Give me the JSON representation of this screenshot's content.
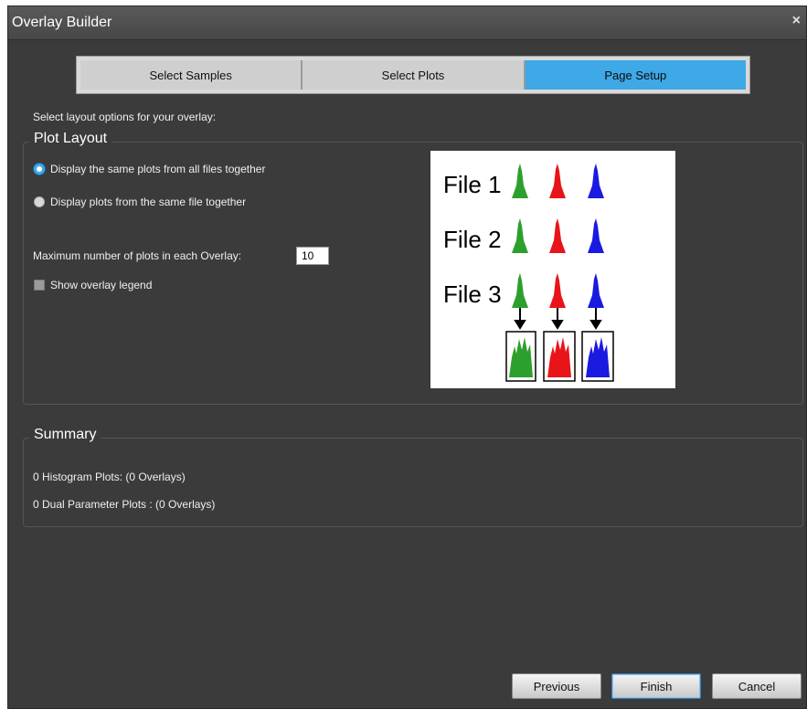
{
  "window": {
    "title": "Overlay Builder",
    "close_glyph": "×"
  },
  "tabs": [
    {
      "label": "Select Samples",
      "active": false
    },
    {
      "label": "Select Plots",
      "active": false
    },
    {
      "label": "Page Setup",
      "active": true
    }
  ],
  "instruction": "Select layout options for your overlay:",
  "plot_layout": {
    "legend": "Plot Layout",
    "option_all_files": "Display the same plots from all files together",
    "option_same_file": "Display plots from the same file together",
    "selected_option": "all_files",
    "max_label": "Maximum number of plots in each Overlay:",
    "max_value": "10",
    "show_legend_label": "Show overlay legend",
    "show_legend_checked": false
  },
  "illustration": {
    "file_labels": [
      "File 1",
      "File 2",
      "File 3"
    ],
    "colors": {
      "green": "#2ca02c",
      "red": "#e8141a",
      "blue": "#1a1ae0"
    }
  },
  "summary": {
    "legend": "Summary",
    "histogram_line": "0 Histogram Plots: (0 Overlays)",
    "dual_line": "0 Dual Parameter Plots : (0 Overlays)"
  },
  "buttons": {
    "previous": "Previous",
    "finish": "Finish",
    "cancel": "Cancel"
  },
  "colors": {
    "accent": "#3fa8e6",
    "background": "#3b3b3b"
  }
}
